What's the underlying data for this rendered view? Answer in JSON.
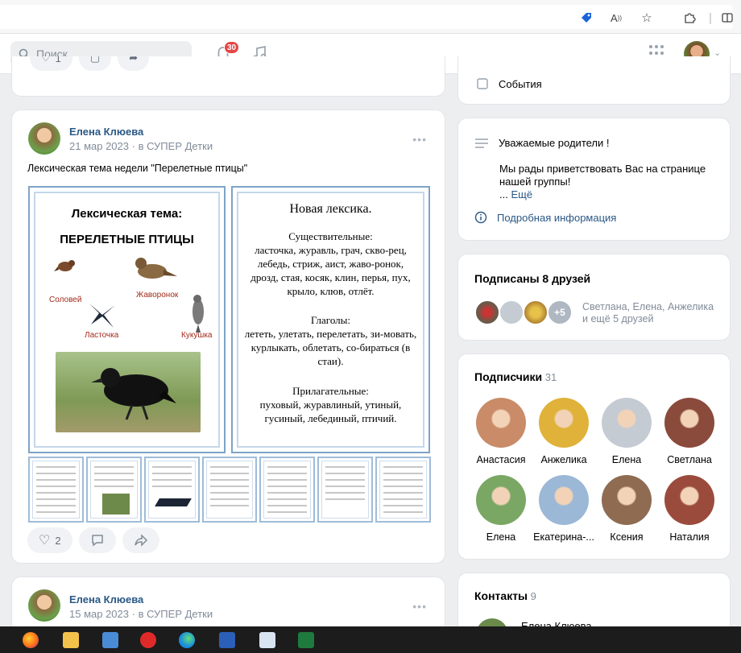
{
  "browser": {
    "read_aloud_label": "A",
    "icons": [
      "tag-icon",
      "read-aloud-icon",
      "favorite-star-icon",
      "extensions-icon",
      "split-screen-icon"
    ]
  },
  "header": {
    "search_placeholder": "Поиск",
    "notifications_count": "30"
  },
  "top_post_stub": {
    "likes": "1"
  },
  "post": {
    "author": "Елена Клюева",
    "date": "21 мар 2023",
    "group": "в СУПЕР Детки",
    "dots": "•••",
    "text": "Лексическая тема недели \"Перелетные птицы\"",
    "image": {
      "left_title": "Лексическая тема:",
      "left_subtitle": "ПЕРЕЛЕТНЫЕ ПТИЦЫ",
      "bird_labels": [
        "Соловей",
        "Жаворонок",
        "Ласточка",
        "Кукушка"
      ],
      "right_title": "Новая лексика.",
      "nouns_heading": "Существительные:",
      "nouns_text": "ласточка, журавль, грач, скво-рец, лебедь, стриж, аист, жаво-ронок, дрозд, стая, косяк, клин, перья, пух, крыло, клюв, отлёт.",
      "verbs_heading": "Глаголы:",
      "verbs_text": "лететь, улетать, перелетать, зи-мовать, курлыкать, облетать, со-бираться (в стаи).",
      "adj_heading": "Прилагательные:",
      "adj_text": "пуховый, журавлиный, утиный, гусиный, лебединый, птичий."
    },
    "likes": "2"
  },
  "next_post": {
    "author": "Елена Клюева",
    "date": "15 мар 2023",
    "group": "в СУПЕР Детки",
    "dots": "•••"
  },
  "sidebar": {
    "events_label": "События",
    "info": {
      "title": "Уважаемые родители !",
      "body": "Мы рады приветствовать Вас на странице нашей группы!",
      "more": "Ещё",
      "more_prefix": "... ",
      "details_link": "Подробная информация"
    },
    "friends": {
      "title": "Подписаны 8 друзей",
      "plus": "+5",
      "names": "Светлана, Елена, Анжелика",
      "more": "и ещё 5 друзей"
    },
    "subscribers": {
      "title": "Подписчики",
      "count": "31",
      "people": [
        {
          "name": "Анастасия",
          "color": "#c98b68"
        },
        {
          "name": "Анжелика",
          "color": "#e0b23a"
        },
        {
          "name": "Елена",
          "color": "#c4cbd3"
        },
        {
          "name": "Светлана",
          "color": "#8a4a3c"
        },
        {
          "name": "Елена",
          "color": "#7aa864"
        },
        {
          "name": "Екатерина-...",
          "color": "#9bb8d6"
        },
        {
          "name": "Ксения",
          "color": "#8f6b52"
        },
        {
          "name": "Наталия",
          "color": "#9b4b3c"
        }
      ]
    },
    "contacts": {
      "title": "Контакты",
      "count": "9",
      "first_contact": "Елена Клюева"
    }
  }
}
